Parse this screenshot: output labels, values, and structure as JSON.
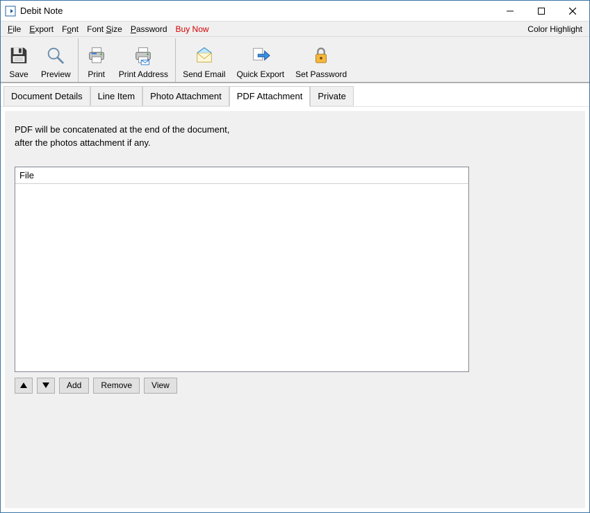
{
  "window": {
    "title": "Debit Note"
  },
  "menu": {
    "file": "File",
    "export": "Export",
    "font": "Font",
    "fontSize": "Font Size",
    "password": "Password",
    "buyNow": "Buy Now",
    "colorHighlight": "Color Highlight"
  },
  "toolbar": {
    "save": "Save",
    "preview": "Preview",
    "print": "Print",
    "printAddress": "Print Address",
    "sendEmail": "Send Email",
    "quickExport": "Quick Export",
    "setPassword": "Set Password"
  },
  "tabs": {
    "documentDetails": "Document Details",
    "lineItem": "Line Item",
    "photoAttachment": "Photo Attachment",
    "pdfAttachment": "PDF Attachment",
    "private": "Private"
  },
  "pdfTab": {
    "infoLine1": "PDF will be concatenated at the end of the document,",
    "infoLine2": "after the photos attachment if any.",
    "fileHeader": "File",
    "add": "Add",
    "remove": "Remove",
    "view": "View"
  }
}
